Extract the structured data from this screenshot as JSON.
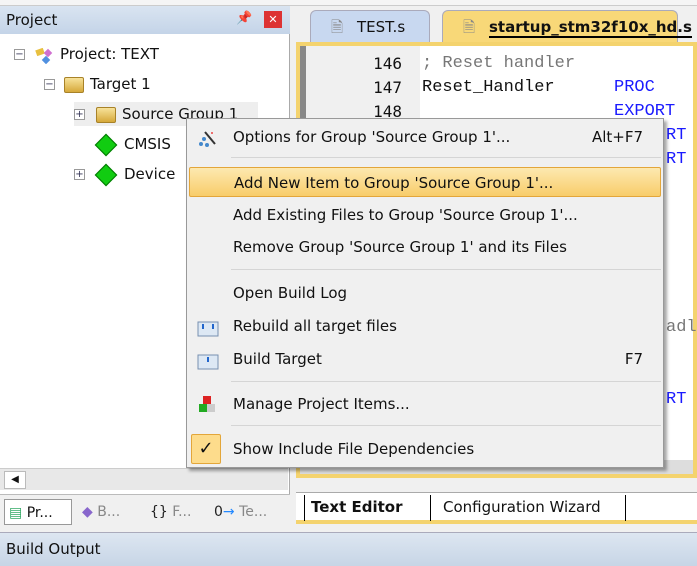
{
  "project_panel": {
    "title": "Project",
    "pin_icon": "pin-icon",
    "close_icon": "close-icon",
    "tree": [
      {
        "label": "Project: TEXT"
      },
      {
        "label": "Target 1"
      },
      {
        "label": "Source Group 1"
      },
      {
        "label": "CMSIS"
      },
      {
        "label": "Device"
      }
    ],
    "tabs": [
      {
        "label": "Pr..."
      },
      {
        "label": "B..."
      },
      {
        "label": "F..."
      },
      {
        "label": "Te..."
      }
    ]
  },
  "editor": {
    "tabs": [
      {
        "label": "TEST.s",
        "active": false
      },
      {
        "label": "startup_stm32f10x_hd.s",
        "active": true
      }
    ],
    "lines": [
      {
        "num": "146",
        "text": "; Reset handler"
      },
      {
        "num": "147",
        "text": "Reset_Handler",
        "kw": "PROC"
      },
      {
        "num": "148",
        "text": "",
        "kw": "EXPORT"
      }
    ],
    "fragments": {
      "f1": "RT",
      "f2": "RT",
      "f3": "adl",
      "f4": "RT"
    },
    "bottom_tabs": [
      {
        "label": "Text Editor",
        "active": true
      },
      {
        "label": "Configuration Wizard",
        "active": false
      }
    ]
  },
  "context_menu": {
    "items": [
      {
        "label": "Options for Group 'Source Group 1'...",
        "shortcut": "Alt+F7",
        "icon": "options-wand-icon"
      },
      {
        "label": "Add New  Item to Group 'Source Group 1'...",
        "highlighted": true
      },
      {
        "label": "Add Existing Files to Group 'Source Group 1'..."
      },
      {
        "label": "Remove Group 'Source Group 1' and its Files"
      },
      {
        "label": "Open Build Log"
      },
      {
        "label": "Rebuild all target files",
        "icon": "rebuild-icon"
      },
      {
        "label": "Build Target",
        "shortcut": "F7",
        "icon": "build-icon"
      },
      {
        "label": "Manage Project Items...",
        "icon": "manage-items-icon"
      },
      {
        "label": "Show Include File Dependencies",
        "checked": true,
        "icon": "check-icon"
      }
    ]
  },
  "build_output": {
    "title": "Build Output"
  },
  "colors": {
    "highlight": "#f8cd6a",
    "keyword": "#1a1aff",
    "accent_border": "#f4d36e"
  }
}
